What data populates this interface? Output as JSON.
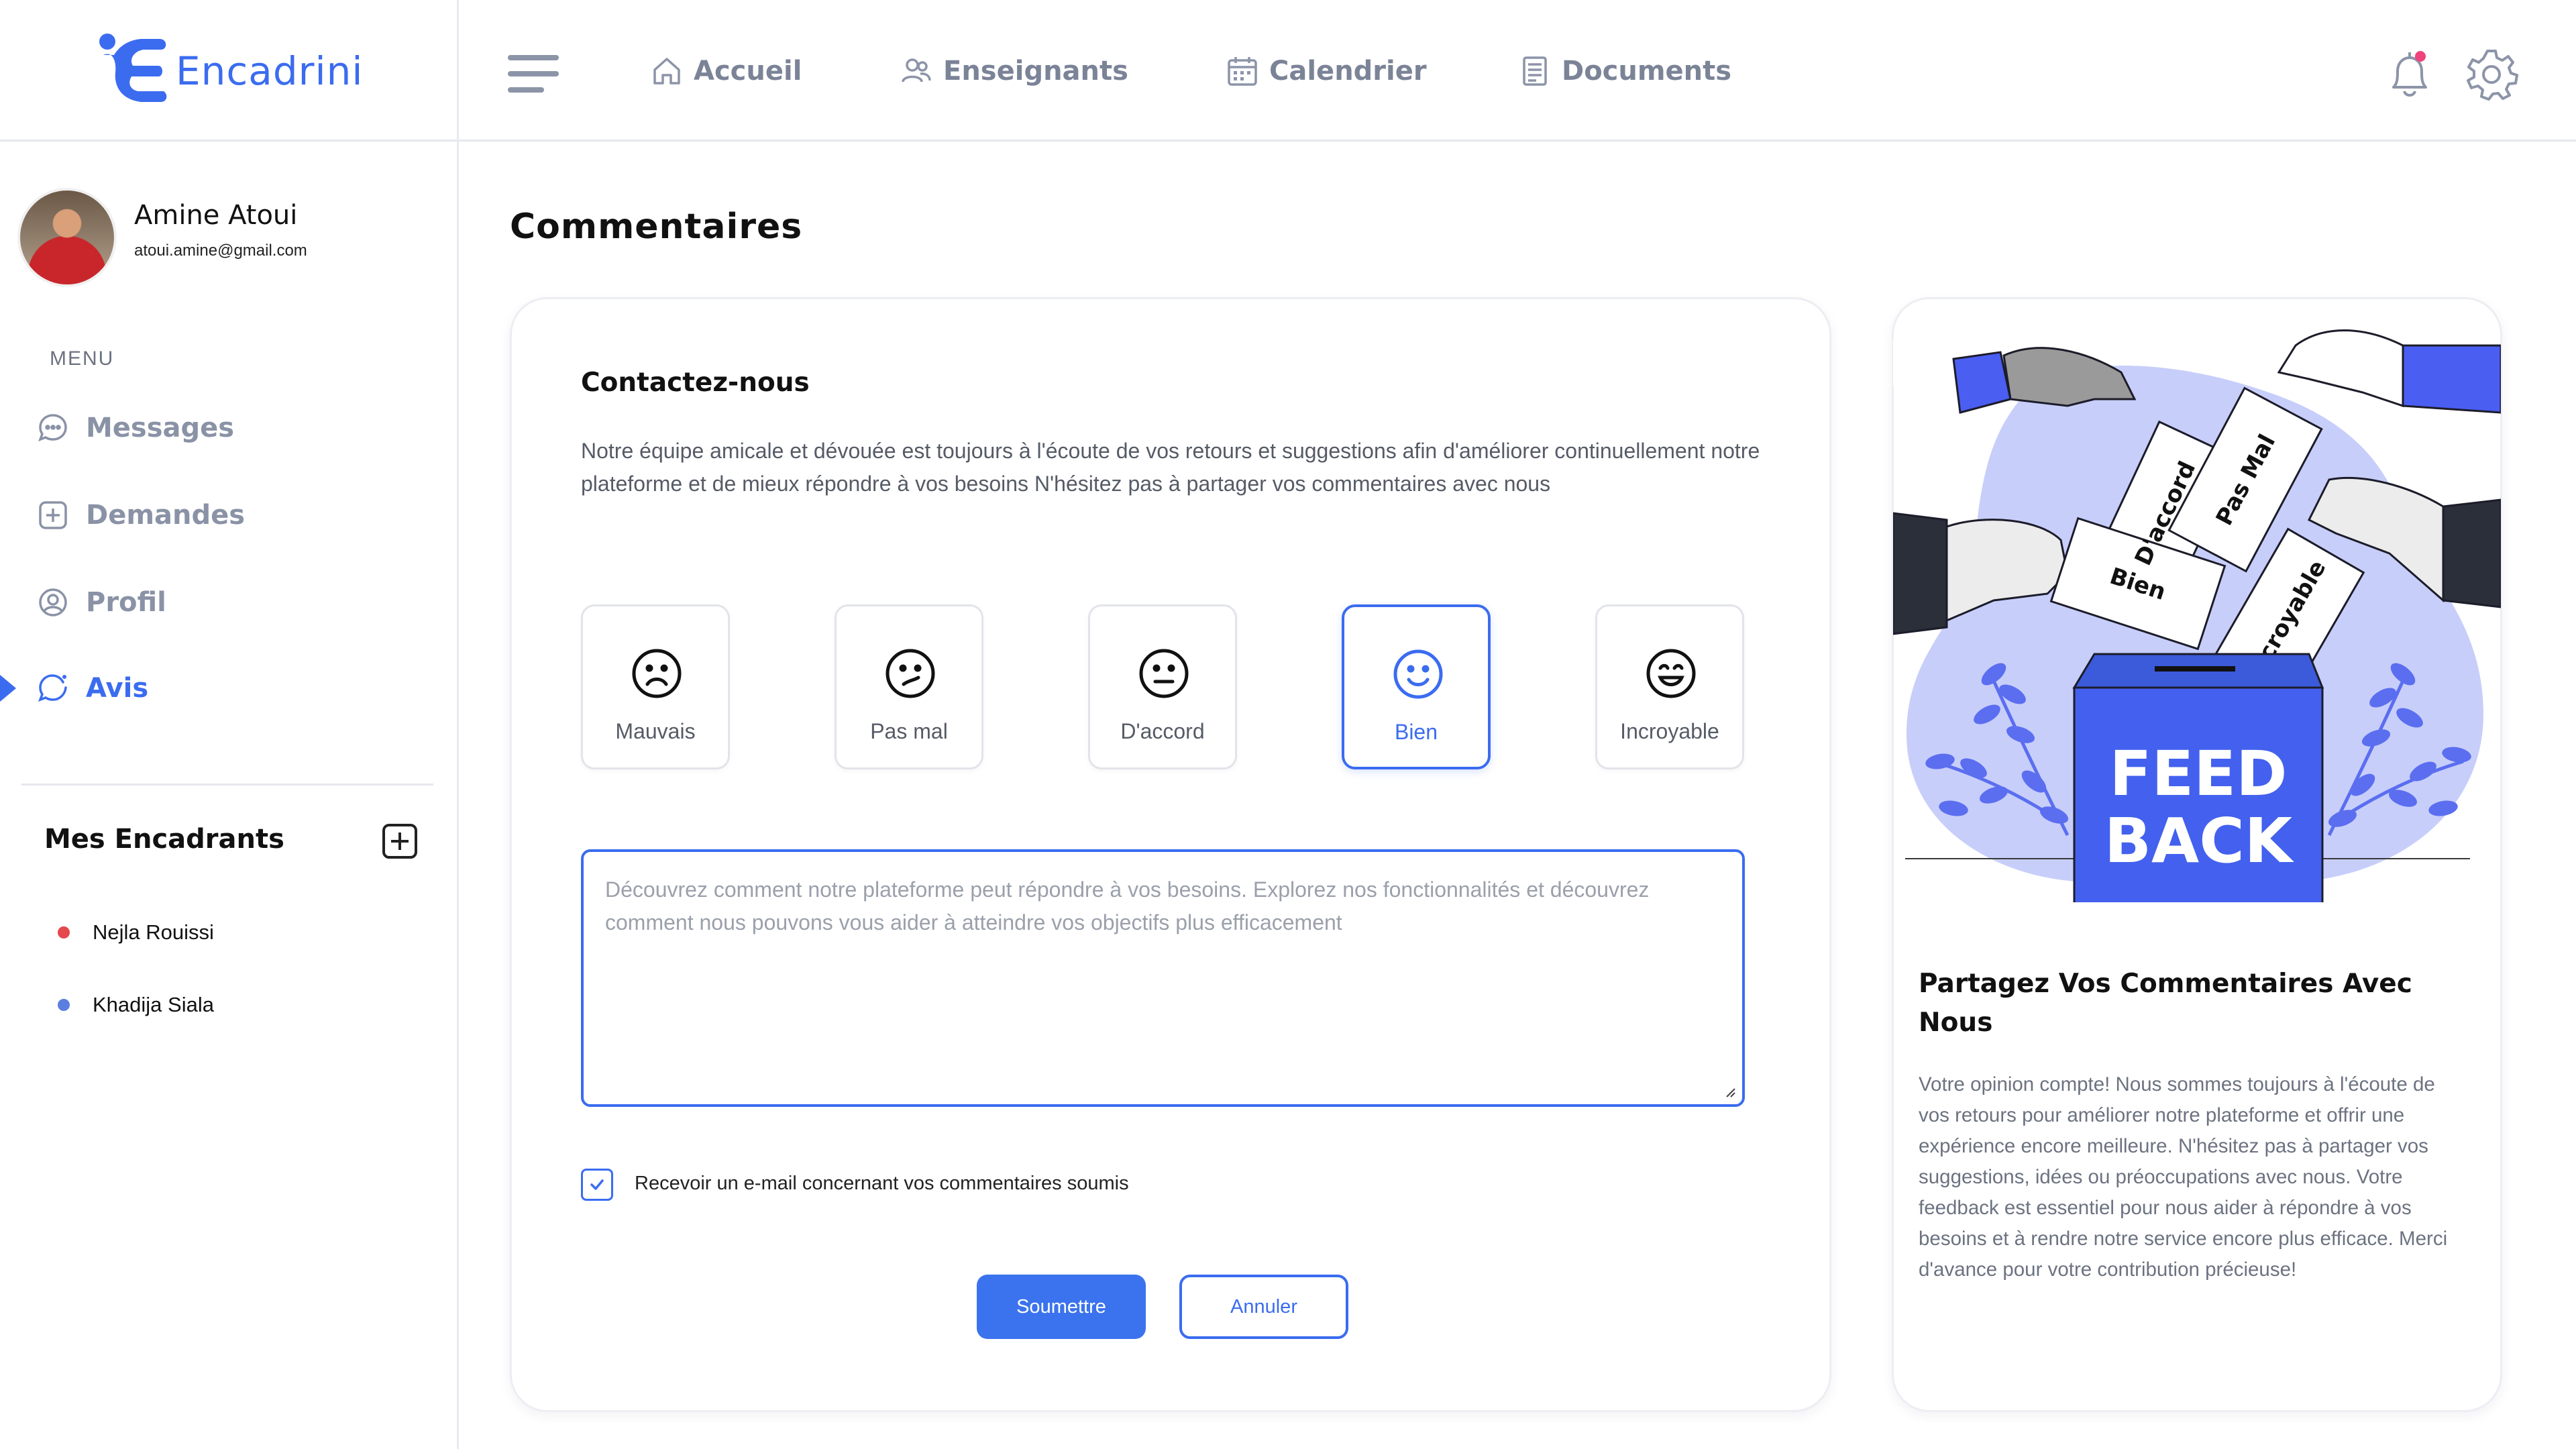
{
  "app": {
    "name": "Encadrini"
  },
  "colors": {
    "accent": "#3b6cf0",
    "muted": "#8a92a6",
    "selected_rating": "#3b6cf0"
  },
  "topnav": {
    "items": [
      {
        "label": "Accueil",
        "icon": "home-icon"
      },
      {
        "label": "Enseignants",
        "icon": "users-icon"
      },
      {
        "label": "Calendrier",
        "icon": "calendar-icon"
      },
      {
        "label": "Documents",
        "icon": "document-icon"
      }
    ],
    "notification_icon": "bell-icon",
    "settings_icon": "gear-icon"
  },
  "user": {
    "name": "Amine Atoui",
    "email": "atoui.amine@gmail.com"
  },
  "sidebar": {
    "menu_title": "MENU",
    "items": [
      {
        "label": "Messages",
        "icon": "chat-icon",
        "active": false
      },
      {
        "label": "Demandes",
        "icon": "plus-square-icon",
        "active": false
      },
      {
        "label": "Profil",
        "icon": "user-circle-icon",
        "active": false
      },
      {
        "label": "Avis",
        "icon": "feedback-icon",
        "active": true
      }
    ],
    "encadrants_title": "Mes Encadrants",
    "encadrants": [
      {
        "name": "Nejla Rouissi",
        "dot_color": "#e5484d"
      },
      {
        "name": "Khadija Siala",
        "dot_color": "#5b7fe0"
      }
    ]
  },
  "main": {
    "title": "Commentaires",
    "contact_title": "Contactez-nous",
    "contact_desc": "Notre équipe amicale et dévouée est toujours à l'écoute de vos retours et suggestions afin d'améliorer continuellement notre plateforme et de mieux répondre à vos besoins N'hésitez pas à partager vos commentaires avec nous",
    "ratings": [
      {
        "label": "Mauvais",
        "icon": "sad-face-icon"
      },
      {
        "label": "Pas mal",
        "icon": "unsure-face-icon"
      },
      {
        "label": "D'accord",
        "icon": "neutral-face-icon"
      },
      {
        "label": "Bien",
        "icon": "smile-face-icon"
      },
      {
        "label": "Incroyable",
        "icon": "happy-face-icon"
      }
    ],
    "selected_rating": "Bien",
    "textarea_placeholder": "Découvrez comment notre plateforme peut répondre à vos besoins. Explorez nos fonctionnalités et découvrez comment nous pouvons vous aider à atteindre vos objectifs plus efficacement",
    "checkbox_label": "Recevoir un e-mail concernant vos commentaires soumis",
    "checkbox_checked": true,
    "submit_label": "Soumettre",
    "cancel_label": "Annuler"
  },
  "feedback_card": {
    "illustration": {
      "cards": [
        "D'accord",
        "Pas Mal",
        "Bien",
        "Incroyable"
      ],
      "box_text_1": "FEED",
      "box_text_2": "BACK"
    },
    "title": "Partagez Vos Commentaires Avec Nous",
    "desc": "Votre opinion compte! Nous sommes toujours à l'écoute de vos retours pour améliorer notre plateforme et offrir une expérience encore meilleure. N'hésitez pas à partager vos suggestions, idées ou préoccupations avec nous. Votre feedback est essentiel pour nous aider à répondre à vos besoins et à rendre notre service encore plus efficace. Merci d'avance pour votre contribution précieuse!"
  }
}
